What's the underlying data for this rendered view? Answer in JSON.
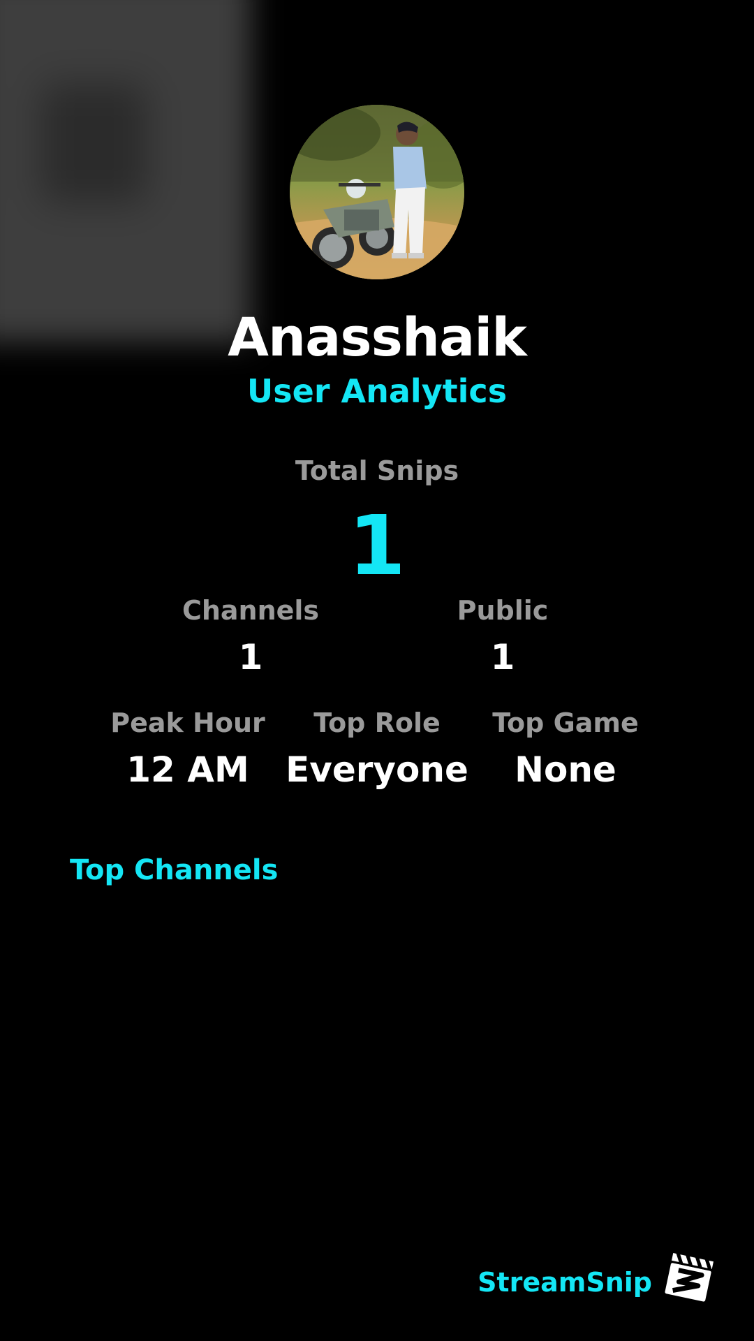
{
  "profile": {
    "username": "Anasshaik",
    "subtitle": "User Analytics"
  },
  "stats": {
    "total_snips_label": "Total Snips",
    "total_snips_value": "1",
    "channels_label": "Channels",
    "channels_value": "1",
    "public_label": "Public",
    "public_value": "1",
    "peak_hour_label": "Peak Hour",
    "peak_hour_value": "12 AM",
    "top_role_label": "Top Role",
    "top_role_value": "Everyone",
    "top_game_label": "Top Game",
    "top_game_value": "None"
  },
  "sections": {
    "top_channels_title": "Top Channels"
  },
  "branding": {
    "name": "StreamSnip",
    "logo_icon": "clapperboard-icon"
  },
  "colors": {
    "accent": "#14e6f5",
    "background": "#000000",
    "label": "#9a9a9a",
    "text": "#ffffff"
  }
}
